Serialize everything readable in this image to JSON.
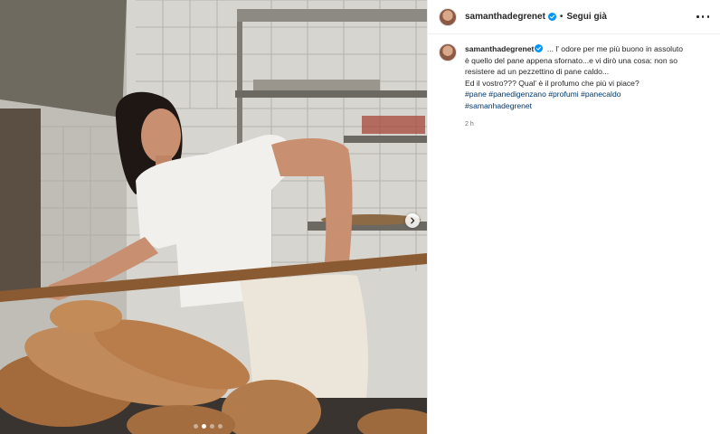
{
  "post": {
    "username": "samanthadegrenet",
    "follow_label": "Segui già",
    "separator": "•",
    "caption": {
      "username": "samanthadegrenet",
      "text_line1": "... l' odore per me più buono in assoluto",
      "text_line2": "è quello del pane appena sfornato...e vi dirò una cosa: non so",
      "text_line3": "resistere ad un pezzettino di pane caldo...",
      "text_line4": "Ed il vostro??? Qual' è il profumo che più vi piace?",
      "hashtags": [
        "#pane",
        "#panedigenzano",
        "#profumi",
        "#panecaldo",
        "#samanhadegrenet"
      ],
      "time": "2 h"
    },
    "carousel": {
      "total": 4,
      "active_index": 1
    }
  },
  "icons": {
    "verified": "verified-badge-icon",
    "more": "more-options-icon",
    "next": "chevron-right-icon"
  },
  "colors": {
    "verified_blue": "#0095f6",
    "hashtag": "#00376b",
    "muted": "#737373"
  }
}
